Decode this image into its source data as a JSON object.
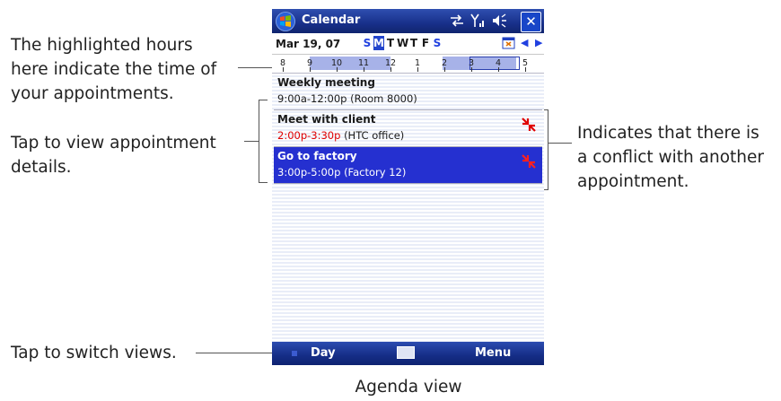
{
  "callouts": {
    "hours": [
      "The highlighted hours",
      "here indicate the time of",
      "your appointments."
    ],
    "details": [
      "Tap to view appointment",
      "details."
    ],
    "conflict": [
      "Indicates that there is",
      "a conflict with another",
      "appointment."
    ],
    "switch": [
      "Tap to switch views."
    ]
  },
  "caption": "Agenda view",
  "app": {
    "title": "Calendar",
    "close": "✕",
    "date": "Mar 19, 07",
    "weekdays": [
      {
        "letter": "S",
        "weekend": true
      },
      {
        "letter": "M",
        "selected": true
      },
      {
        "letter": "T"
      },
      {
        "letter": "W"
      },
      {
        "letter": "T"
      },
      {
        "letter": "F"
      },
      {
        "letter": "S",
        "weekend": true
      }
    ],
    "hours": [
      "8",
      "9",
      "10",
      "11",
      "12",
      "1",
      "2",
      "3",
      "4",
      "5"
    ],
    "appointments": [
      {
        "title": "Weekly meeting",
        "time": "9:00a-12:00p",
        "location": "(Room 8000)",
        "conflict": false,
        "selected": false,
        "time_red": false
      },
      {
        "title": "Meet with client",
        "time": "2:00p-3:30p",
        "location": "(HTC office)",
        "conflict": true,
        "selected": false,
        "time_red": true
      },
      {
        "title": "Go to factory",
        "time": "3:00p-5:00p",
        "location": "(Factory 12)",
        "conflict": true,
        "selected": true,
        "time_red": false
      }
    ],
    "softkeys": {
      "left": "Day",
      "right": "Menu"
    }
  },
  "colors": {
    "titlebar": "#1a3490",
    "selection": "#2530d0",
    "conflict": "#e00000",
    "highlight": "#a7b2e8"
  }
}
